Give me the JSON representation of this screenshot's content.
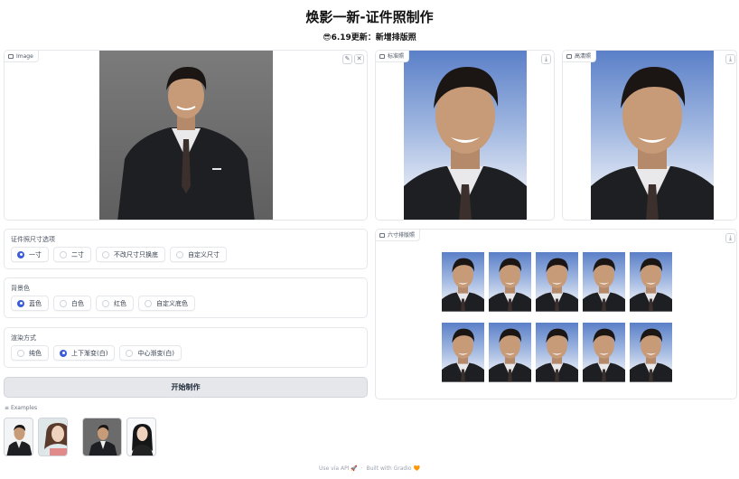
{
  "header": {
    "title": "焕影一新-证件照制作",
    "subtitle": "😎6.19更新：新增排版照"
  },
  "image_input": {
    "label": "Image",
    "edit_icon": "pencil-icon",
    "clear_icon": "close-icon"
  },
  "standard_output": {
    "label": "标准照",
    "download_icon": "download-icon"
  },
  "hd_output": {
    "label": "高清照",
    "download_icon": "download-icon"
  },
  "layout_output": {
    "label": "六寸排版照",
    "download_icon": "download-icon"
  },
  "size_options": {
    "legend": "证件照尺寸选项",
    "options": [
      "一寸",
      "二寸",
      "不改尺寸只换底",
      "自定义尺寸"
    ],
    "selected": "一寸"
  },
  "bg_options": {
    "legend": "背景色",
    "options": [
      "蓝色",
      "白色",
      "红色",
      "自定义底色"
    ],
    "selected": "蓝色"
  },
  "render_options": {
    "legend": "渲染方式",
    "options": [
      "纯色",
      "上下渐变(白)",
      "中心渐变(白)"
    ],
    "selected": "上下渐变(白)"
  },
  "actions": {
    "start_label": "开始制作"
  },
  "examples": {
    "label": "Examples"
  },
  "footer": {
    "api": "Use via API",
    "built": "Built with Gradio"
  },
  "colors": {
    "accent": "#3b5bdb",
    "blue_bg": "#5b80c8",
    "gray_bg": "#6b6b6b"
  }
}
